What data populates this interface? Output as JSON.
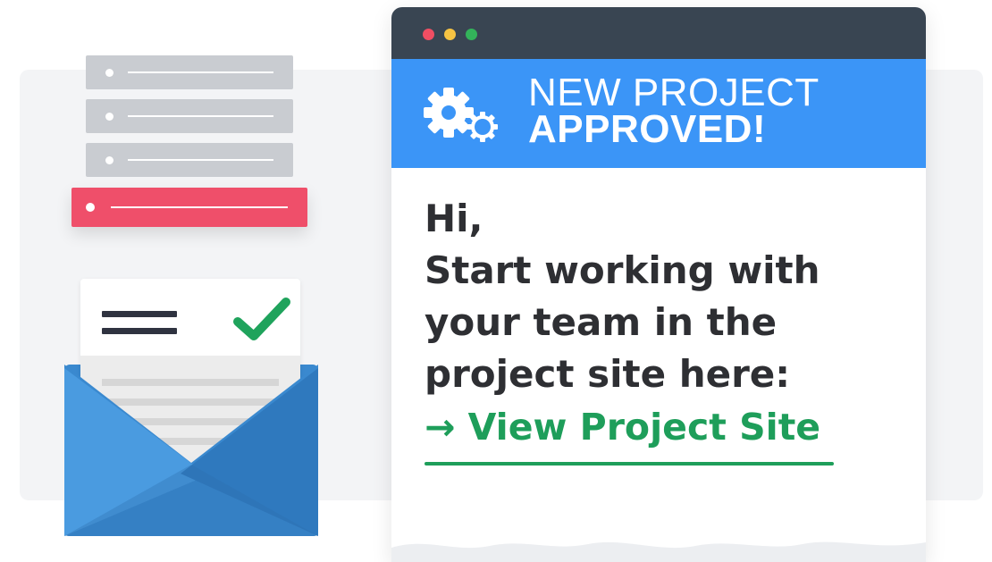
{
  "window": {
    "titlebar_dots": [
      "#f04e63",
      "#f6c343",
      "#33b35a"
    ],
    "banner": {
      "line1": "NEW PROJECT",
      "line2": "APPROVED!",
      "icon": "gears-icon",
      "color": "#3b95f7"
    },
    "message": {
      "greeting": "Hi,",
      "lines": [
        "Start working with",
        "your team in the",
        "project site here:"
      ]
    },
    "cta": {
      "label": "→ View Project Site",
      "color": "#1e9e5a"
    }
  },
  "list": {
    "rows": [
      {
        "state": "inactive",
        "color": "#c9ccd1"
      },
      {
        "state": "inactive",
        "color": "#c9ccd1"
      },
      {
        "state": "inactive",
        "color": "#c9ccd1"
      },
      {
        "state": "active",
        "color": "#ef4f6a"
      }
    ]
  },
  "envelope": {
    "color": "#3a89cf",
    "letter_icons": [
      "menu-icon",
      "checkmark-icon"
    ],
    "check_color": "#1fa35c"
  }
}
